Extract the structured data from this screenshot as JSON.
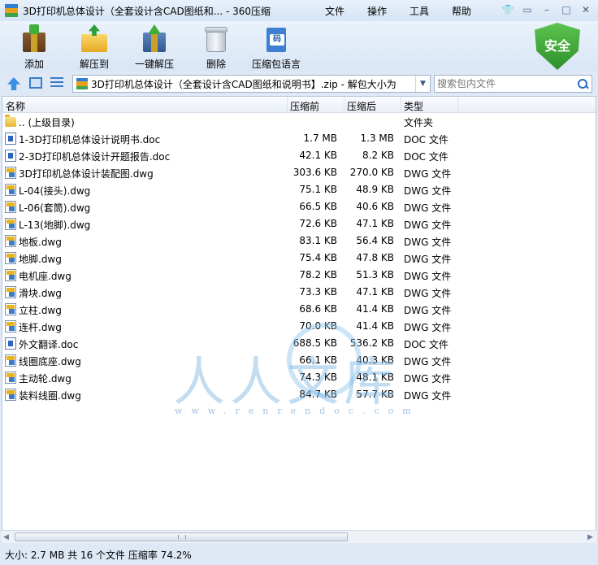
{
  "window": {
    "title": "3D打印机总体设计（全套设计含CAD图纸和... - 360压缩",
    "menu": [
      "文件",
      "操作",
      "工具",
      "帮助"
    ]
  },
  "toolbar": {
    "add_label": "添加",
    "extract_label": "解压到",
    "one_click_label": "一键解压",
    "delete_label": "删除",
    "lang_label": "压缩包语言",
    "lang_icon_char": "码",
    "safe_label": "安全"
  },
  "address": {
    "path": "3D打印机总体设计（全套设计含CAD图纸和说明书】.zip - 解包大小为",
    "search_placeholder": "搜索包内文件"
  },
  "columns": {
    "name": "名称",
    "compressed": "压缩前",
    "original": "压缩后",
    "type": "类型"
  },
  "files": [
    {
      "name": ".. (上级目录)",
      "comp": "",
      "orig": "",
      "type": "文件夹",
      "icon": "folder"
    },
    {
      "name": "1-3D打印机总体设计说明书.doc",
      "comp": "1.7 MB",
      "orig": "1.3 MB",
      "type": "DOC 文件",
      "icon": "doc"
    },
    {
      "name": "2-3D打印机总体设计开题报告.doc",
      "comp": "42.1 KB",
      "orig": "8.2 KB",
      "type": "DOC 文件",
      "icon": "doc"
    },
    {
      "name": "3D打印机总体设计装配图.dwg",
      "comp": "303.6 KB",
      "orig": "270.0 KB",
      "type": "DWG 文件",
      "icon": "dwg"
    },
    {
      "name": "L-04(接头).dwg",
      "comp": "75.1 KB",
      "orig": "48.9 KB",
      "type": "DWG 文件",
      "icon": "dwg"
    },
    {
      "name": "L-06(套筒).dwg",
      "comp": "66.5 KB",
      "orig": "40.6 KB",
      "type": "DWG 文件",
      "icon": "dwg"
    },
    {
      "name": "L-13(地脚).dwg",
      "comp": "72.6 KB",
      "orig": "47.1 KB",
      "type": "DWG 文件",
      "icon": "dwg"
    },
    {
      "name": "地板.dwg",
      "comp": "83.1 KB",
      "orig": "56.4 KB",
      "type": "DWG 文件",
      "icon": "dwg"
    },
    {
      "name": "地脚.dwg",
      "comp": "75.4 KB",
      "orig": "47.8 KB",
      "type": "DWG 文件",
      "icon": "dwg"
    },
    {
      "name": "电机座.dwg",
      "comp": "78.2 KB",
      "orig": "51.3 KB",
      "type": "DWG 文件",
      "icon": "dwg"
    },
    {
      "name": "滑块.dwg",
      "comp": "73.3 KB",
      "orig": "47.1 KB",
      "type": "DWG 文件",
      "icon": "dwg"
    },
    {
      "name": "立柱.dwg",
      "comp": "68.6 KB",
      "orig": "41.4 KB",
      "type": "DWG 文件",
      "icon": "dwg"
    },
    {
      "name": "连杆.dwg",
      "comp": "70.0 KB",
      "orig": "41.4 KB",
      "type": "DWG 文件",
      "icon": "dwg"
    },
    {
      "name": "外文翻译.doc",
      "comp": "688.5 KB",
      "orig": "536.2 KB",
      "type": "DOC 文件",
      "icon": "doc"
    },
    {
      "name": "线圈底座.dwg",
      "comp": "66.1 KB",
      "orig": "40.3 KB",
      "type": "DWG 文件",
      "icon": "dwg"
    },
    {
      "name": "主动轮.dwg",
      "comp": "74.3 KB",
      "orig": "48.1 KB",
      "type": "DWG 文件",
      "icon": "dwg"
    },
    {
      "name": "装料线圈.dwg",
      "comp": "84.7 KB",
      "orig": "57.7 KB",
      "type": "DWG 文件",
      "icon": "dwg"
    }
  ],
  "watermark": {
    "text": "人人文库",
    "url": "www.renrendoc.com"
  },
  "status": {
    "text": "大小: 2.7 MB 共 16 个文件 压缩率 74.2%"
  }
}
